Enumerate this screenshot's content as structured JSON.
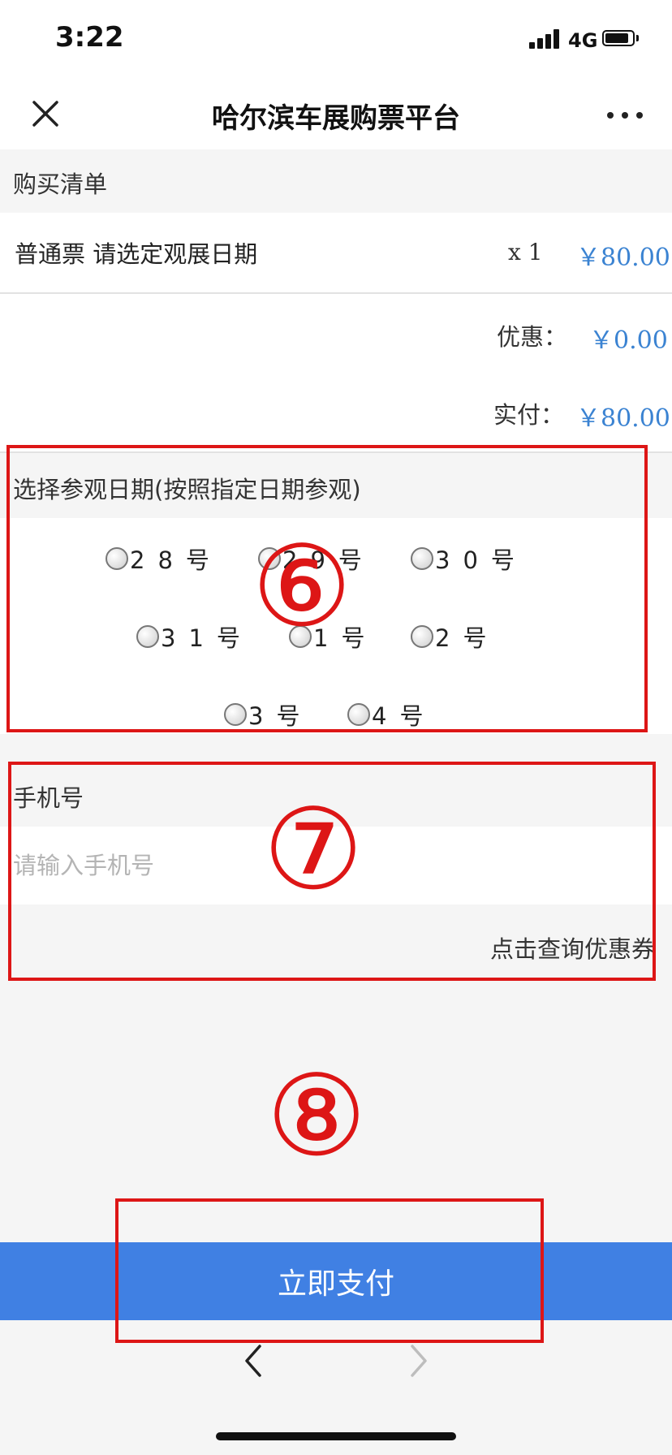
{
  "status_bar": {
    "time": "3:22",
    "network": "4G"
  },
  "nav": {
    "title": "哈尔滨车展购票平台"
  },
  "order": {
    "section_title": "购买清单",
    "item_name": "普通票 请选定观展日期",
    "quantity": "x 1",
    "price": "￥80.00",
    "discount_label": "优惠：",
    "discount_value": "￥0.00",
    "paid_label": "实付：",
    "paid_value": "￥80.00"
  },
  "date_select": {
    "title": "选择参观日期(按照指定日期参观)",
    "options": [
      "28号",
      "29号",
      "30号",
      "31号",
      "1号",
      "2号",
      "3号",
      "4号"
    ]
  },
  "phone": {
    "title": "手机号",
    "placeholder": "请输入手机号",
    "coupon_link": "点击查询优惠券"
  },
  "annotations": {
    "six": "⑥",
    "seven": "⑦",
    "eight": "⑧"
  },
  "pay": {
    "button_label": "立即支付"
  },
  "colors": {
    "accent_blue": "#4080e3",
    "price_blue": "#3b83d2",
    "annotation_red": "#dd1616"
  },
  "icons": {
    "close": "close-icon",
    "more": "more-icon",
    "back": "chevron-left-icon",
    "forward": "chevron-right-icon"
  }
}
